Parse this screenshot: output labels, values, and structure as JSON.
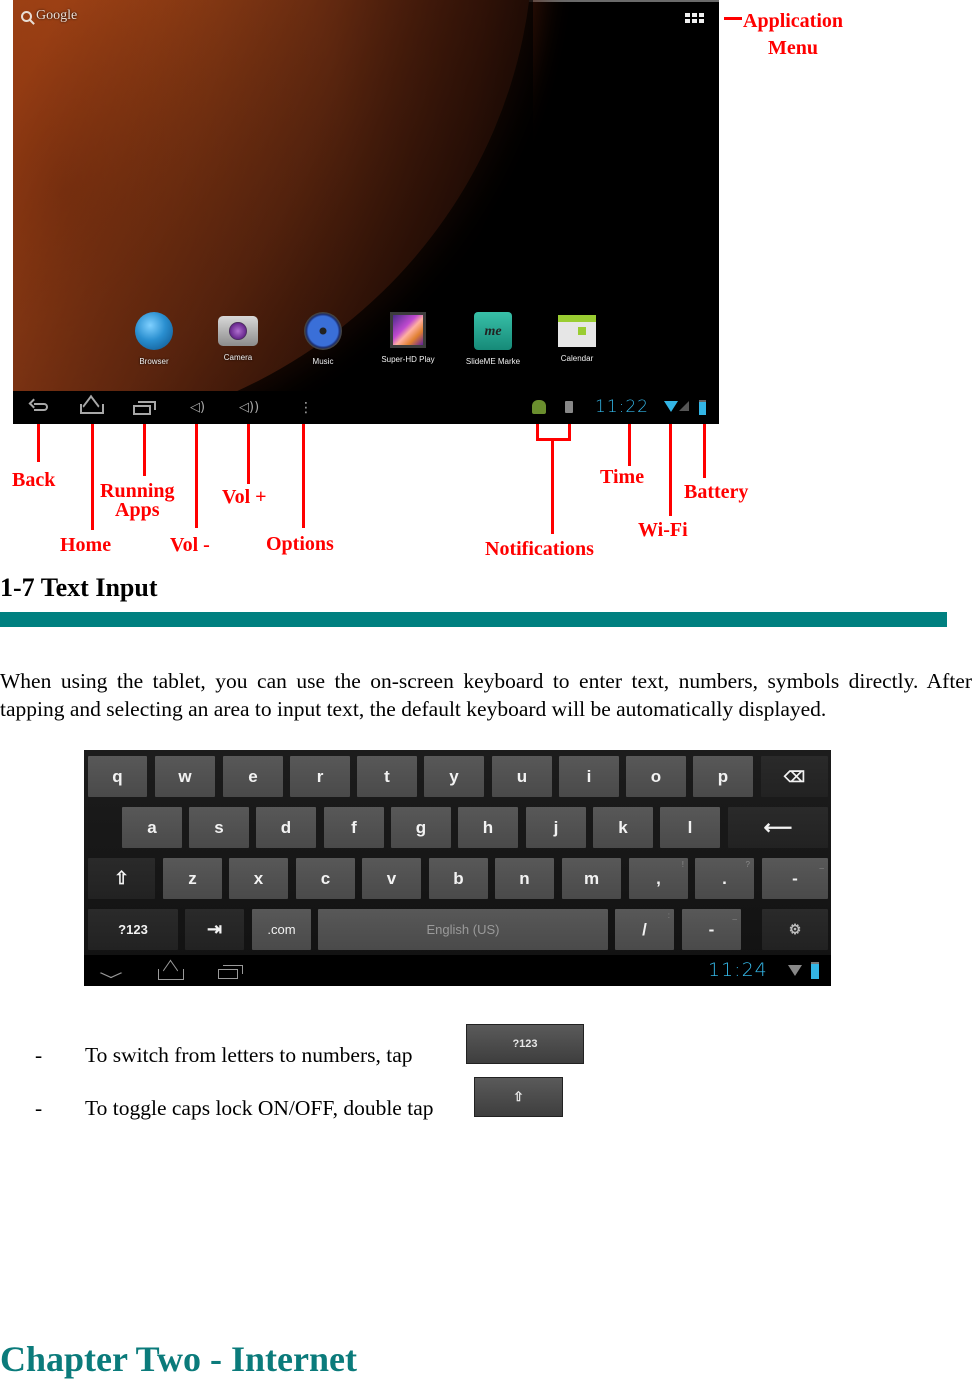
{
  "homescreen": {
    "search_label": "Google",
    "apps": [
      {
        "label": "Browser",
        "icon": "globe-icon"
      },
      {
        "label": "Camera",
        "icon": "camera-icon"
      },
      {
        "label": "Music",
        "icon": "speaker-icon"
      },
      {
        "label": "Super-HD Play",
        "icon": "video-player-icon"
      },
      {
        "label": "SlideME Marke",
        "icon": "slideme-market-icon"
      },
      {
        "label": "Calendar",
        "icon": "calendar-icon"
      }
    ],
    "navbar": {
      "vol_down_glyph": "◁)",
      "vol_up_glyph": "◁))",
      "options_glyph": "⋮",
      "time": "11:22"
    }
  },
  "callouts": {
    "application_menu": "Application\nMenu",
    "back": "Back",
    "home": "Home",
    "running_apps_line1": "Running",
    "running_apps_line2": "Apps",
    "vol_down": "Vol -",
    "vol_up": "Vol +",
    "options": "Options",
    "notifications": "Notifications",
    "time": "Time",
    "wifi": "Wi-Fi",
    "battery": "Battery"
  },
  "section": {
    "title": "1-7 Text Input",
    "rule_color": "#008080",
    "paragraph": "When using the tablet, you can use the on-screen keyboard to enter text, numbers, symbols directly. After tapping and selecting an area to input text, the default keyboard will be automatically displayed."
  },
  "keyboard": {
    "row1": [
      "q",
      "w",
      "e",
      "r",
      "t",
      "y",
      "u",
      "i",
      "o",
      "p"
    ],
    "backspace_glyph": "⌫",
    "row2": [
      "a",
      "s",
      "d",
      "f",
      "g",
      "h",
      "j",
      "k",
      "l"
    ],
    "enter_glyph": "⟵",
    "shift_glyph": "⇧",
    "row3": [
      "z",
      "x",
      "c",
      "v",
      "b",
      "n",
      "m"
    ],
    "comma": ",",
    "comma_hint": "!",
    "period": ".",
    "period_hint": "?",
    "dash": "-",
    "dash_hint": "_",
    "symbols_label": "?123",
    "tab_glyph": "⇥",
    "dotcom_label": ".com",
    "dotcom_hint": "...",
    "space_label": "English (US)",
    "slash": "/",
    "slash_hint": ":",
    "minus": "-",
    "minus_hint": "_",
    "settings_glyph": "⚙",
    "status_time": "11:24"
  },
  "bullets": [
    {
      "dash": "-",
      "text": "To switch from letters to numbers, tap",
      "key_label": "?123"
    },
    {
      "dash": "-",
      "text": "To toggle caps lock ON/OFF, double tap",
      "key_label": "⇧"
    }
  ],
  "chapter": {
    "title": "Chapter Two - Internet",
    "color": "#0b7b7b"
  },
  "accent": {
    "callout_red": "#ff0000",
    "status_blue": "#33b5e5"
  }
}
